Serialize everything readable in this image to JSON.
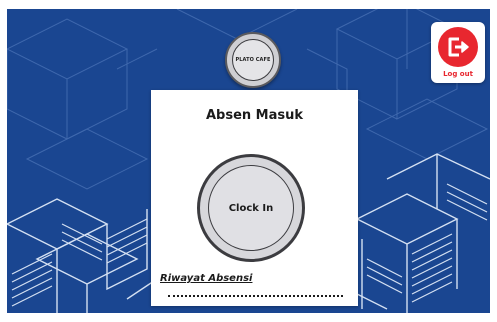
{
  "logo": {
    "text": "PLATO CAFE",
    "icon": "plato-cafe-logo"
  },
  "card": {
    "title": "Absen Masuk",
    "clock_in_label": "Clock In",
    "history_link": "Riwayat Absensi"
  },
  "logout": {
    "label": "Log out",
    "icon": "logout-icon"
  },
  "colors": {
    "background": "#1a4691",
    "logout_accent": "#e8272f",
    "card": "#ffffff"
  }
}
